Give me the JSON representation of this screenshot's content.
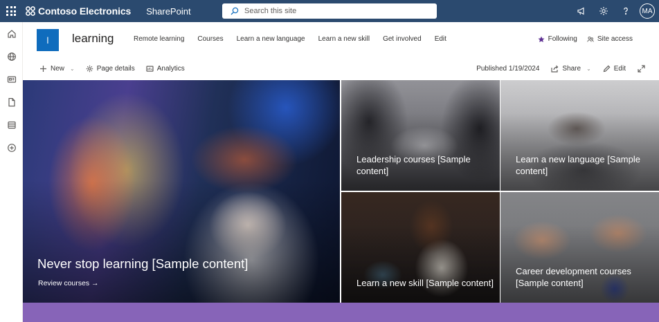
{
  "suite": {
    "brand_name": "Contoso Electronics",
    "app_name": "SharePoint",
    "search_placeholder": "Search this site",
    "avatar_initials": "MA"
  },
  "site": {
    "logo_letter": "l",
    "title": "learning",
    "nav": [
      "Remote learning",
      "Courses",
      "Learn a new language",
      "Learn a new skill",
      "Get involved",
      "Edit"
    ],
    "following_label": "Following",
    "access_label": "Site access"
  },
  "commands": {
    "new_label": "New",
    "page_details_label": "Page details",
    "analytics_label": "Analytics",
    "published_label": "Published 1/19/2024",
    "share_label": "Share",
    "edit_label": "Edit"
  },
  "hero": {
    "main": {
      "title": "Never stop learning [Sample content]",
      "link": "Review courses →"
    },
    "tiles": [
      {
        "title": "Leadership courses [Sample content]"
      },
      {
        "title": "Learn a new language [Sample content]"
      },
      {
        "title": "Learn a new skill [Sample content]"
      },
      {
        "title": "Career development courses [Sample content]"
      }
    ]
  },
  "colors": {
    "suite_bar": "#2b4a6f",
    "site_logo": "#0f6cbd",
    "band": "#8764b8"
  }
}
